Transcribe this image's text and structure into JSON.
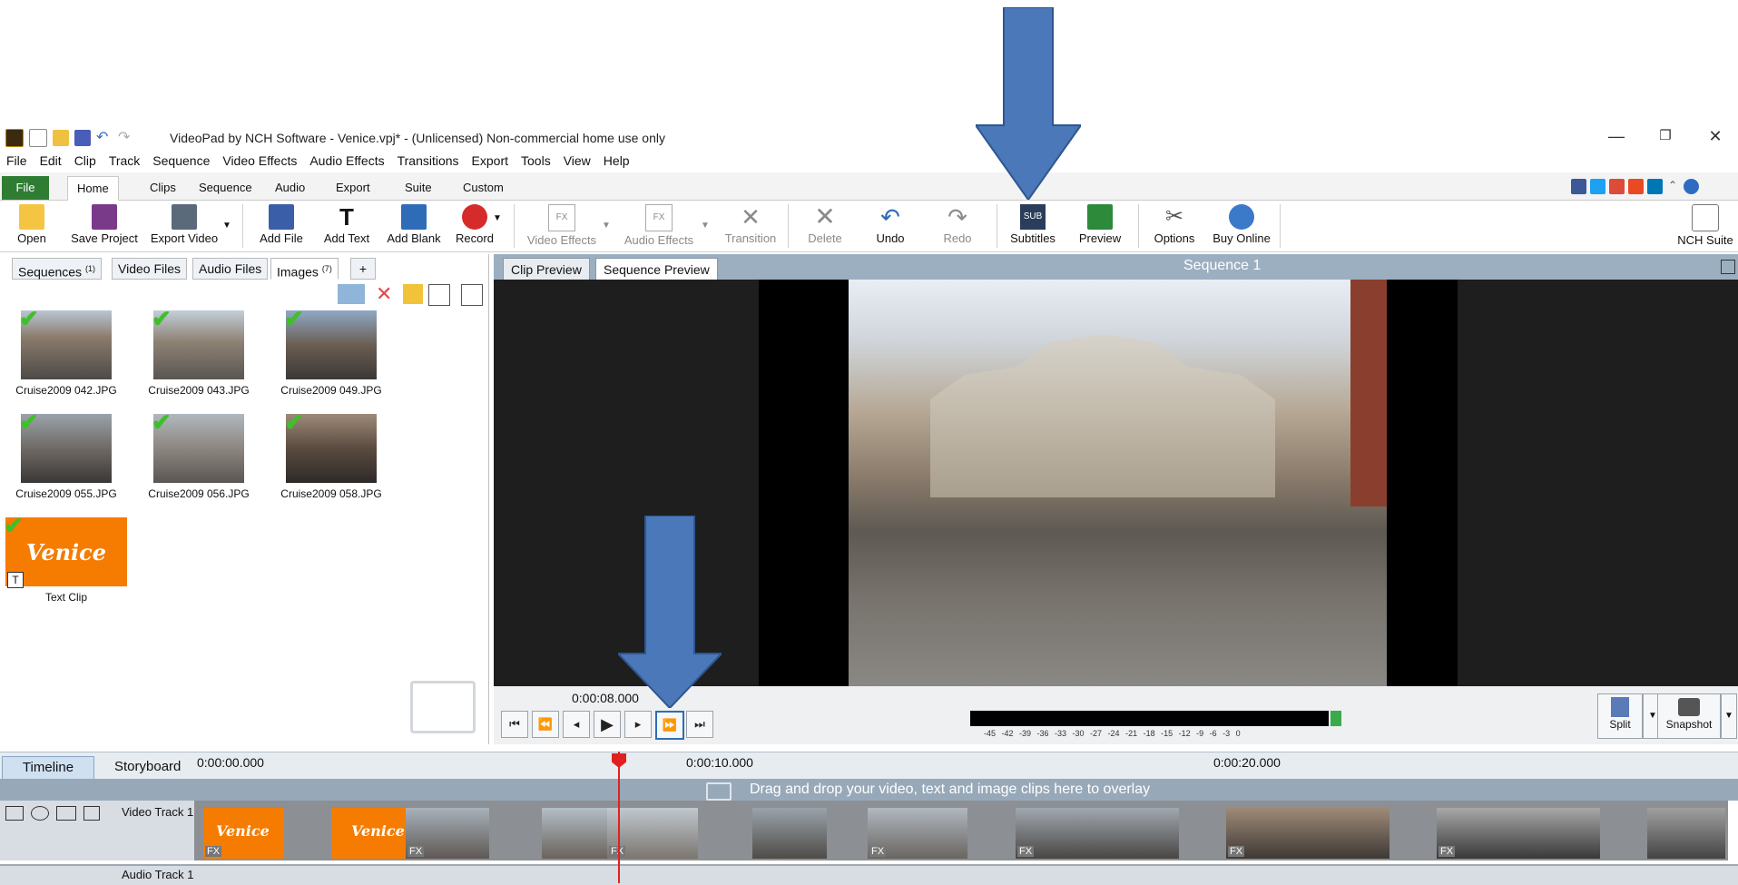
{
  "window": {
    "title": "VideoPad by NCH Software - Venice.vpj* - (Unlicensed) Non-commercial home use only",
    "controls": [
      "—",
      "❐",
      "✕"
    ]
  },
  "menu": [
    "File",
    "Edit",
    "Clip",
    "Track",
    "Sequence",
    "Video Effects",
    "Audio Effects",
    "Transitions",
    "Export",
    "Tools",
    "View",
    "Help"
  ],
  "ribbon_tabs": [
    "File",
    "Home",
    "Clips",
    "Sequence",
    "Audio",
    "Export",
    "Suite",
    "Custom"
  ],
  "ribbon": {
    "open": "Open",
    "save_project": "Save Project",
    "export_video": "Export Video",
    "add_file": "Add File",
    "add_text": "Add Text",
    "add_blank": "Add Blank",
    "record": "Record",
    "video_effects": "Video Effects",
    "audio_effects": "Audio Effects",
    "transition": "Transition",
    "delete": "Delete",
    "undo": "Undo",
    "redo": "Redo",
    "subtitles": "Subtitles",
    "preview": "Preview",
    "options": "Options",
    "buy_online": "Buy Online",
    "nch_suite": "NCH Suite",
    "sub_icon_text": "SUB",
    "fx_icon_text": "FX"
  },
  "bin_tabs": {
    "sequences": "Sequences",
    "sequences_count": "(1)",
    "video_files": "Video Files",
    "audio_files": "Audio Files",
    "images": "Images",
    "images_count": "(7)",
    "add": "+"
  },
  "images": [
    {
      "name": "Cruise2009 042.JPG"
    },
    {
      "name": "Cruise2009 043.JPG"
    },
    {
      "name": "Cruise2009 049.JPG"
    },
    {
      "name": "Cruise2009 055.JPG"
    },
    {
      "name": "Cruise2009 056.JPG"
    },
    {
      "name": "Cruise2009 058.JPG"
    },
    {
      "name": "Text Clip",
      "text": "Venice"
    }
  ],
  "preview": {
    "clip_preview": "Clip Preview",
    "sequence_preview": "Sequence Preview",
    "sequence_title": "Sequence 1",
    "timecode": "0:00:08.000",
    "meter_scale": "-45 -42 -39 -36 -33 -30 -27 -24 -21 -18 -15 -12 -9 -6 -3 0",
    "split": "Split",
    "snapshot": "Snapshot"
  },
  "timeline": {
    "tab_timeline": "Timeline",
    "tab_storyboard": "Storyboard",
    "t0": "0:00:00.000",
    "t10": "0:00:10.000",
    "t20": "0:00:20.000",
    "overlay_hint": "Drag and drop your video, text and image clips here to overlay",
    "video_track": "Video Track 1",
    "audio_track": "Audio Track 1",
    "clip_text": "Venice",
    "fx_label": "FX"
  },
  "colors": {
    "accent_green": "#2f7d32",
    "arrow_blue": "#4a78b8",
    "text_clip_orange": "#f57c00",
    "playhead_red": "#e02020"
  }
}
